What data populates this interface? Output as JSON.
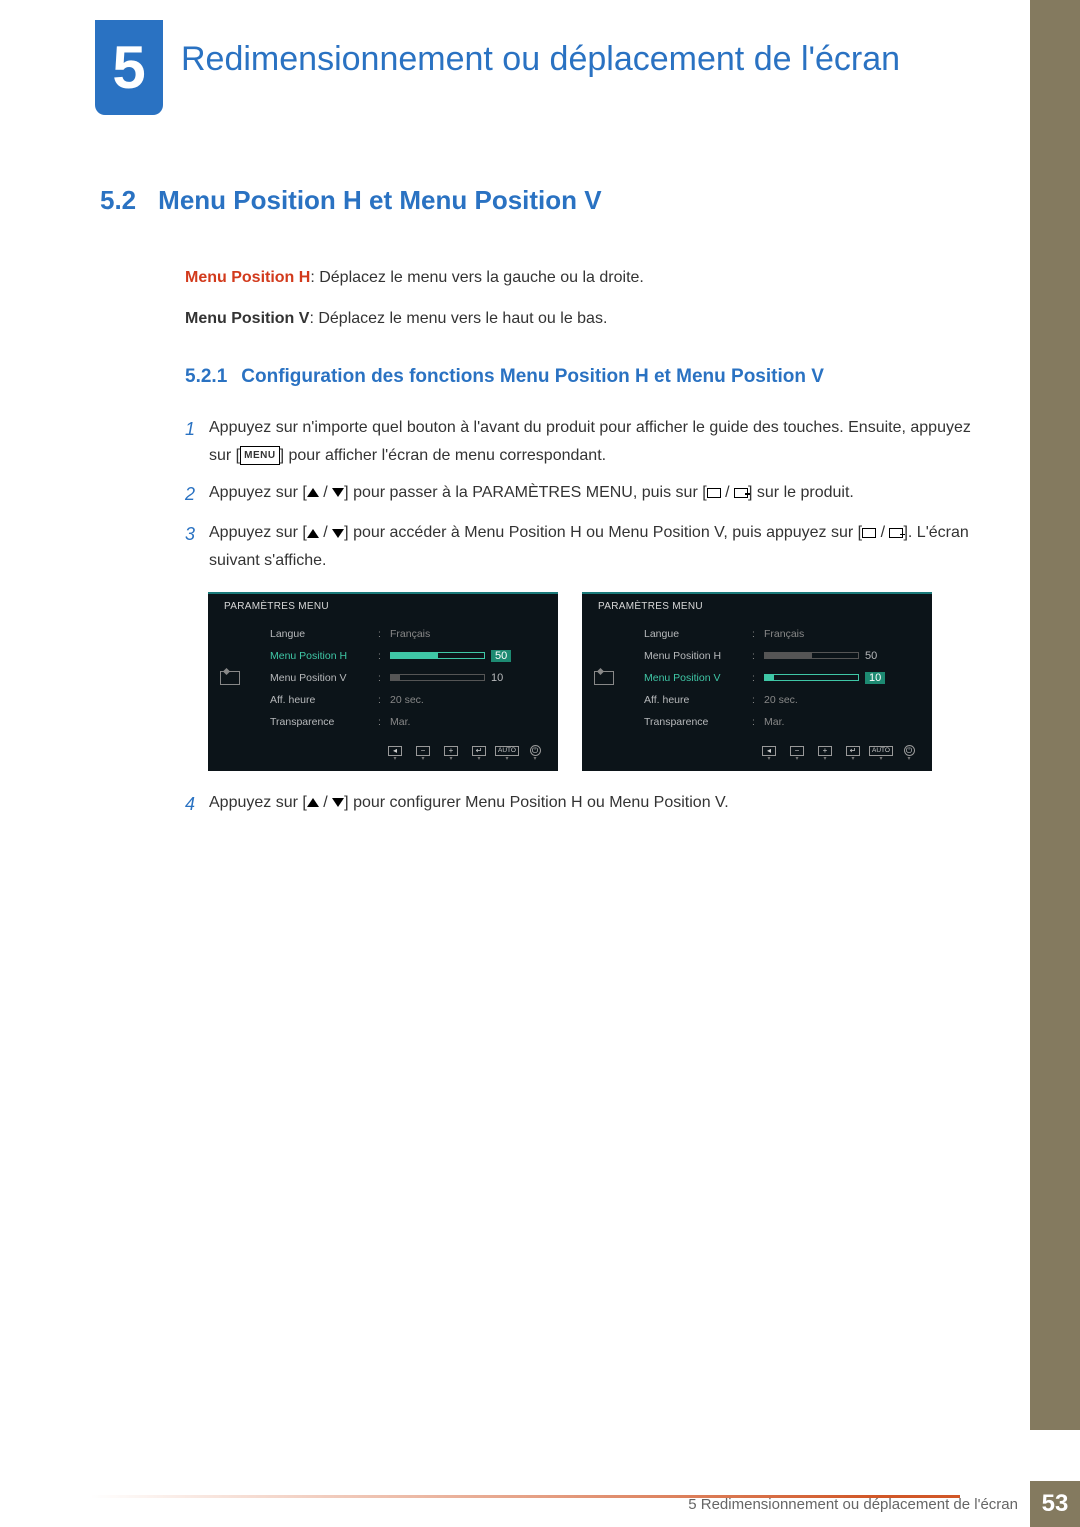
{
  "chapter": {
    "number": "5",
    "title": "Redimensionnement ou déplacement de l'écran"
  },
  "section": {
    "number": "5.2",
    "title": "Menu Position H et Menu Position V"
  },
  "intro": {
    "ph_label": "Menu Position H",
    "ph_desc": ": Déplacez le menu vers la gauche ou la droite.",
    "pv_label": "Menu Position V",
    "pv_desc": ": Déplacez le menu vers le haut ou le bas."
  },
  "subsection": {
    "number": "5.2.1",
    "title": "Configuration des fonctions Menu Position H et Menu Position V"
  },
  "steps": {
    "s1": {
      "n": "1",
      "a": "Appuyez sur n'importe quel bouton à l'avant du produit pour afficher le guide des touches. Ensuite, appuyez sur [",
      "menu": "MENU",
      "b": "] pour afficher l'écran de menu correspondant."
    },
    "s2": {
      "n": "2",
      "a": "Appuyez sur [",
      "b": "] pour passer à la ",
      "param": "PARAMÈTRES MENU",
      "c": ", puis sur [",
      "d": "] sur le produit."
    },
    "s3": {
      "n": "3",
      "a": "Appuyez sur [",
      "b": "] pour accéder à ",
      "ph": "Menu Position H",
      "or": " ou ",
      "pv": "Menu Position V",
      "c": ", puis appuyez sur [",
      "d": "]. L'écran suivant s'affiche."
    },
    "s4": {
      "n": "4",
      "a": "Appuyez sur [",
      "b": "] pour configurer ",
      "ph": "Menu Position H",
      "or": " ou ",
      "pv": "Menu Position V",
      "end": "."
    }
  },
  "osd": {
    "title": "PARAMÈTRES MENU",
    "items": {
      "langue": {
        "label": "Langue",
        "value": "Français"
      },
      "posH": {
        "label": "Menu Position H",
        "value": "50"
      },
      "posV": {
        "label": "Menu Position V",
        "value": "10"
      },
      "aff": {
        "label": "Aff. heure",
        "value": "20 sec."
      },
      "trans": {
        "label": "Transparence",
        "value": "Mar."
      }
    },
    "nav": {
      "auto": "AUTO"
    }
  },
  "footer": {
    "text": "5 Redimensionnement ou déplacement de l'écran",
    "page": "53"
  }
}
